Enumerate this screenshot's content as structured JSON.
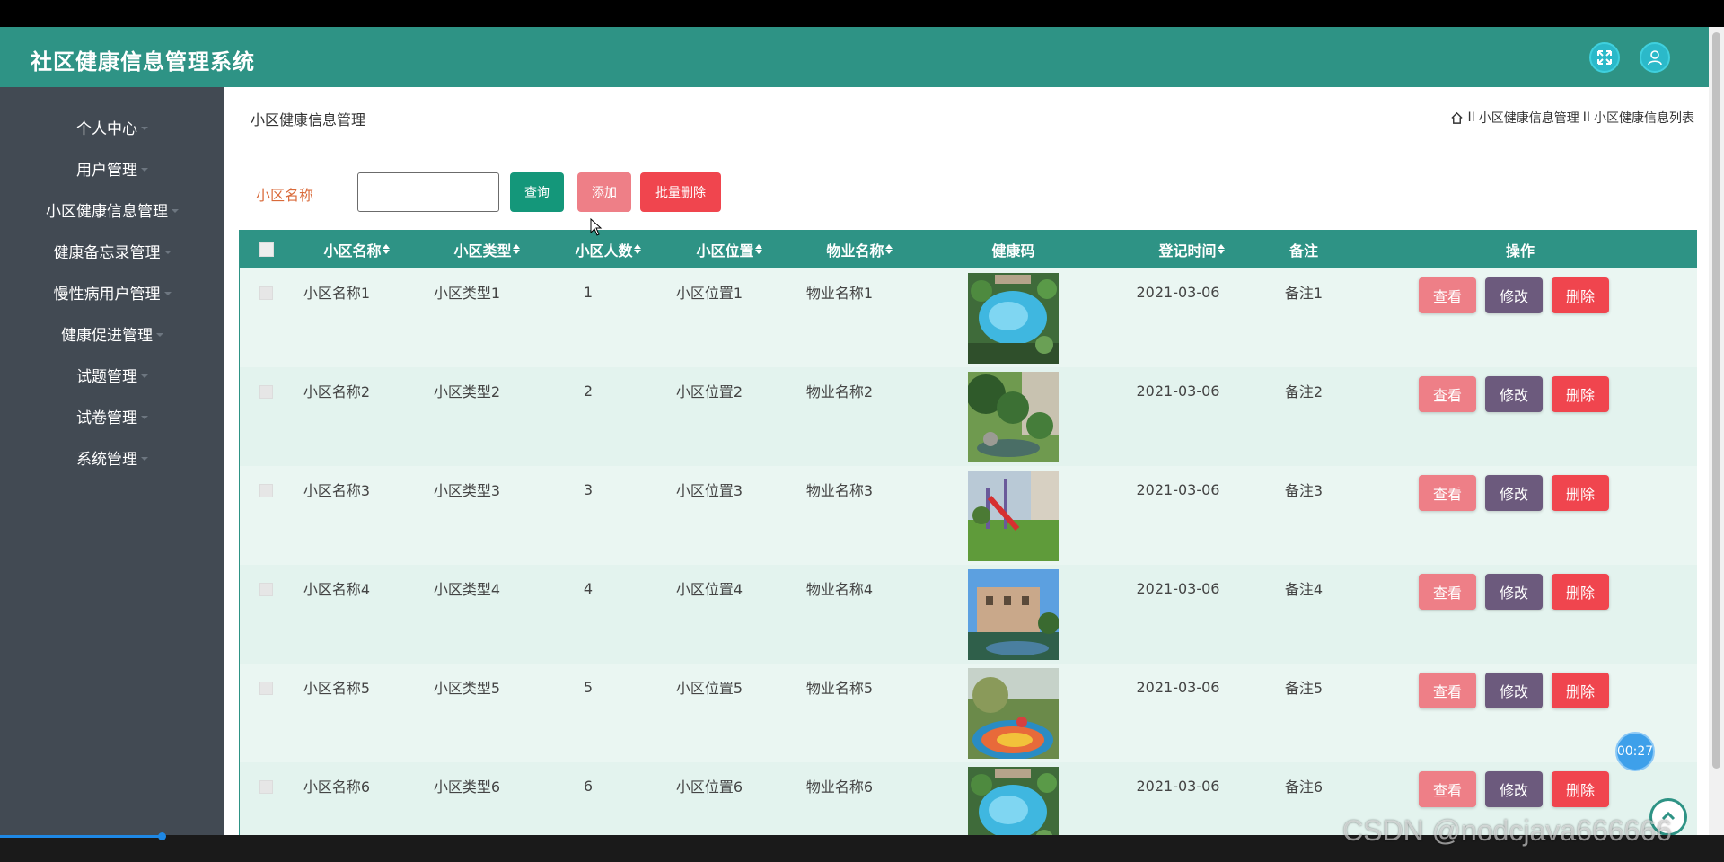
{
  "app": {
    "title": "社区健康信息管理系统"
  },
  "header": {
    "fullscreen_icon": "fullscreen-icon",
    "user_icon": "user-icon",
    "accent": "#2e9385"
  },
  "sidebar": {
    "items": [
      {
        "label": "个人中心"
      },
      {
        "label": "用户管理"
      },
      {
        "label": "小区健康信息管理"
      },
      {
        "label": "健康备忘录管理"
      },
      {
        "label": "慢性病用户管理"
      },
      {
        "label": "健康促进管理"
      },
      {
        "label": "试题管理"
      },
      {
        "label": "试卷管理"
      },
      {
        "label": "系统管理"
      }
    ]
  },
  "page": {
    "title": "小区健康信息管理",
    "breadcrumb": {
      "home_icon": "home-icon",
      "separator": "II",
      "level1": "小区健康信息管理",
      "level2": "小区健康信息列表"
    }
  },
  "search": {
    "label": "小区名称",
    "value": "",
    "query_label": "查询",
    "add_label": "添加",
    "batch_delete_label": "批量删除"
  },
  "table": {
    "headers": [
      "小区名称",
      "小区类型",
      "小区人数",
      "小区位置",
      "物业名称",
      "健康码",
      "登记时间",
      "备注",
      "操作"
    ],
    "rows": [
      {
        "name": "小区名称1",
        "type": "小区类型1",
        "count": "1",
        "location": "小区位置1",
        "property": "物业名称1",
        "date": "2021-03-06",
        "note": "备注1",
        "image": "pool"
      },
      {
        "name": "小区名称2",
        "type": "小区类型2",
        "count": "2",
        "location": "小区位置2",
        "property": "物业名称2",
        "date": "2021-03-06",
        "note": "备注2",
        "image": "garden"
      },
      {
        "name": "小区名称3",
        "type": "小区类型3",
        "count": "3",
        "location": "小区位置3",
        "property": "物业名称3",
        "date": "2021-03-06",
        "note": "备注3",
        "image": "playground"
      },
      {
        "name": "小区名称4",
        "type": "小区类型4",
        "count": "4",
        "location": "小区位置4",
        "property": "物业名称4",
        "date": "2021-03-06",
        "note": "备注4",
        "image": "building"
      },
      {
        "name": "小区名称5",
        "type": "小区类型5",
        "count": "5",
        "location": "小区位置5",
        "property": "物业名称5",
        "date": "2021-03-06",
        "note": "备注5",
        "image": "park"
      },
      {
        "name": "小区名称6",
        "type": "小区类型6",
        "count": "6",
        "location": "小区位置6",
        "property": "物业名称6",
        "date": "2021-03-06",
        "note": "备注6",
        "image": "pool"
      }
    ],
    "actions": {
      "view": "查看",
      "edit": "修改",
      "delete": "删除"
    }
  },
  "overlay": {
    "timer": "00:27",
    "watermark": "CSDN @nodcjava666666"
  }
}
